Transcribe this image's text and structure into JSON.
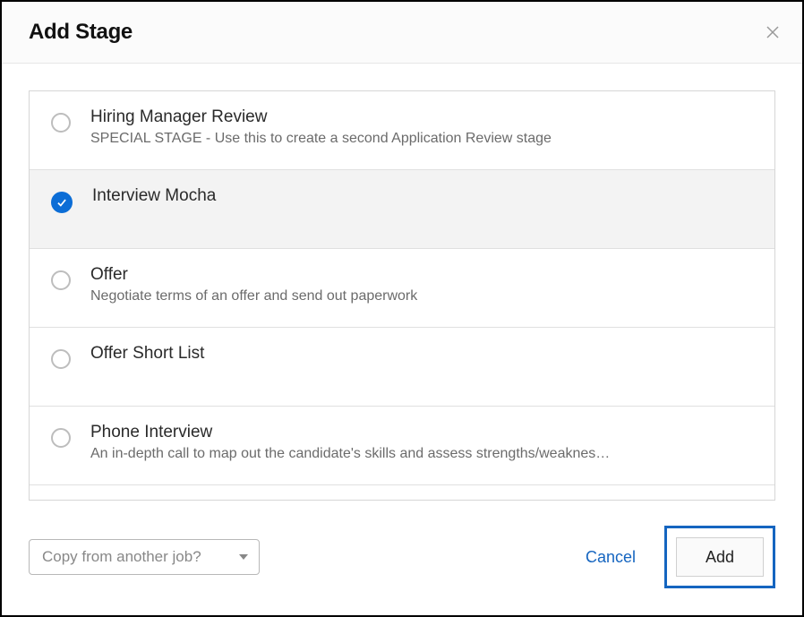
{
  "header": {
    "title": "Add Stage"
  },
  "stages": [
    {
      "name": "Hiring Manager Review",
      "desc": "SPECIAL STAGE - Use this to create a second Application Review stage",
      "selected": false
    },
    {
      "name": "Interview Mocha",
      "desc": "",
      "selected": true
    },
    {
      "name": "Offer",
      "desc": "Negotiate terms of an offer and send out paperwork",
      "selected": false
    },
    {
      "name": "Offer Short List",
      "desc": "",
      "selected": false
    },
    {
      "name": "Phone Interview",
      "desc": "An in-depth call to map out the candidate's skills and assess strengths/weaknes…",
      "selected": false
    }
  ],
  "footer": {
    "copy_placeholder": "Copy from another job?",
    "cancel_label": "Cancel",
    "add_label": "Add"
  }
}
